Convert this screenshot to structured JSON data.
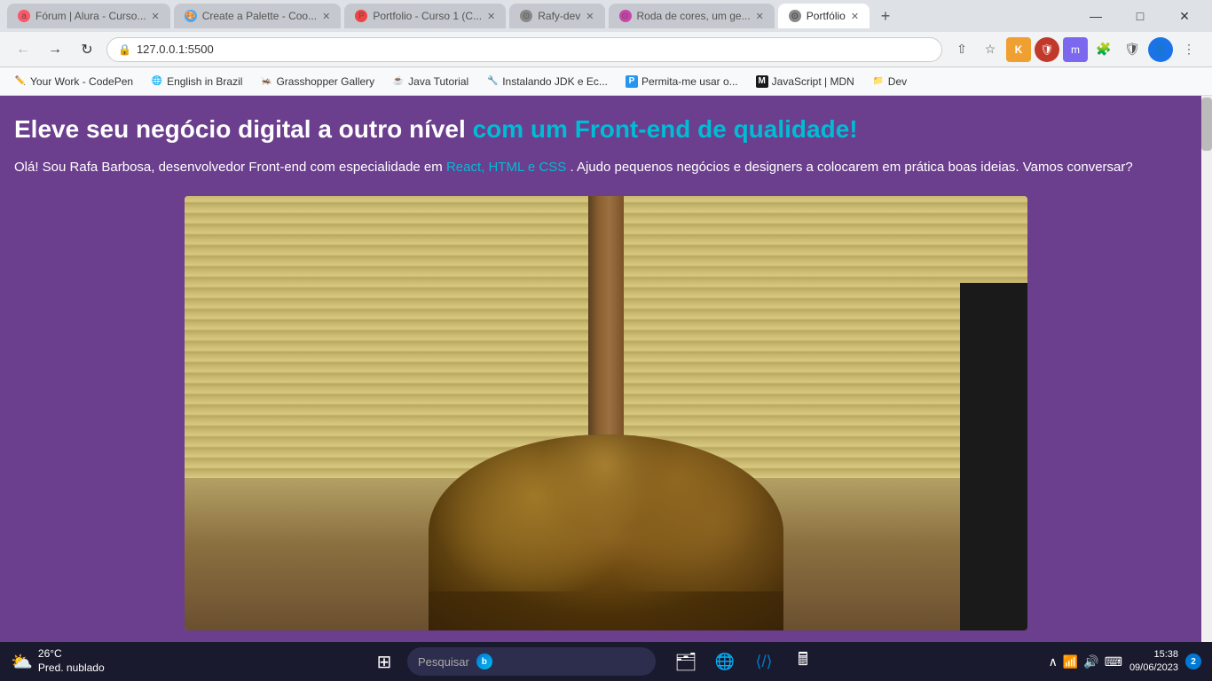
{
  "browser": {
    "tabs": [
      {
        "id": "tab1",
        "label": "Fórum | Alura - Curso...",
        "favicon_color": "#f56",
        "active": false
      },
      {
        "id": "tab2",
        "label": "Create a Palette - Coo...",
        "favicon_color": "#4af",
        "active": false
      },
      {
        "id": "tab3",
        "label": "Portfolio - Curso 1 (C...",
        "favicon_color": "#e44",
        "active": false
      },
      {
        "id": "tab4",
        "label": "Rafy-dev",
        "favicon_color": "#888",
        "active": false
      },
      {
        "id": "tab5",
        "label": "Roda de cores, um ge...",
        "favicon_color": "#c4a",
        "active": false
      },
      {
        "id": "tab6",
        "label": "Portfólio",
        "favicon_color": "#888",
        "active": true
      }
    ],
    "url": "127.0.0.1:5500",
    "url_display": "127.0.0.1:5500"
  },
  "bookmarks": [
    {
      "label": "Your Work - CodePen",
      "icon": "✏️"
    },
    {
      "label": "English in Brazil",
      "icon": "🌐"
    },
    {
      "label": "Grasshopper Gallery",
      "icon": "🦗"
    },
    {
      "label": "Java Tutorial",
      "icon": "☕"
    },
    {
      "label": "Instalando JDK e Ec...",
      "icon": "🔧"
    },
    {
      "label": "Permita-me usar o...",
      "icon": "P"
    },
    {
      "label": "JavaScript | MDN",
      "icon": "M"
    },
    {
      "label": "Dev",
      "icon": "📁"
    }
  ],
  "page": {
    "hero_title_black": "Eleve seu negócio digital a outro nível",
    "hero_title_accent": "com um Front-end de qualidade!",
    "hero_subtitle_before": "Olá! Sou Rafa Barbosa, desenvolvedor Front-end com especialidade em",
    "hero_subtitle_link": "React, HTML e CSS",
    "hero_subtitle_after": ". Ajudo pequenos negócios e designers a colocarem em prática boas ideias. Vamos conversar?"
  },
  "taskbar": {
    "weather_temp": "26°C",
    "weather_desc": "Pred. nublado",
    "search_placeholder": "Pesquisar",
    "clock_time": "15:38",
    "clock_date": "09/06/2023",
    "notification_count": "2"
  },
  "colors": {
    "page_bg": "#6b3e8e",
    "accent": "#00bcd4",
    "title_white": "#ffffff"
  }
}
